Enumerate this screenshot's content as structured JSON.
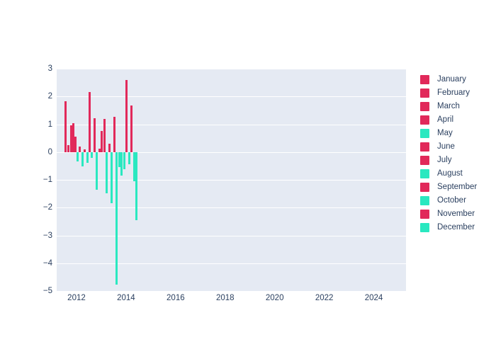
{
  "chart_data": {
    "type": "bar",
    "title": "",
    "subtitle": "",
    "xlabel": "",
    "ylabel": "",
    "xlim": [
      2011.2,
      2025.3
    ],
    "ylim": [
      -5,
      3
    ],
    "xtick_labels": [
      "2012",
      "2014",
      "2016",
      "2018",
      "2020",
      "2022",
      "2024"
    ],
    "xtick_values": [
      2012,
      2014,
      2016,
      2018,
      2020,
      2022,
      2024
    ],
    "ytick_labels": [
      "3",
      "2",
      "1",
      "0",
      "−1",
      "−2",
      "−3",
      "−4",
      "−5"
    ],
    "ytick_values": [
      3,
      2,
      1,
      0,
      -1,
      -2,
      -3,
      -4,
      -5
    ],
    "grid": true,
    "grid_color": "#ffffff",
    "plot_bgcolor": "#e5eaf3",
    "paper_bgcolor": "#ffffff",
    "legend_position": "right",
    "positive_color": "#e1295a",
    "negative_color": "#2ae8c0",
    "legend": [
      {
        "label": "January",
        "color": "#e1295a"
      },
      {
        "label": "February",
        "color": "#e1295a"
      },
      {
        "label": "March",
        "color": "#e1295a"
      },
      {
        "label": "April",
        "color": "#e1295a"
      },
      {
        "label": "May",
        "color": "#2ae8c0"
      },
      {
        "label": "June",
        "color": "#e1295a"
      },
      {
        "label": "July",
        "color": "#e1295a"
      },
      {
        "label": "August",
        "color": "#2ae8c0"
      },
      {
        "label": "September",
        "color": "#e1295a"
      },
      {
        "label": "October",
        "color": "#2ae8c0"
      },
      {
        "label": "November",
        "color": "#e1295a"
      },
      {
        "label": "December",
        "color": "#2ae8c0"
      }
    ],
    "x": [
      2011.55,
      2011.68,
      2011.78,
      2011.87,
      2011.96,
      2012.05,
      2012.14,
      2012.24,
      2012.33,
      2012.43,
      2012.52,
      2012.62,
      2012.72,
      2012.82,
      2012.92,
      2013.02,
      2013.12,
      2013.22,
      2013.32,
      2013.42,
      2013.52,
      2013.62,
      2013.72,
      2013.82,
      2013.92,
      2014.02,
      2014.12,
      2014.22,
      2014.32,
      2014.42
    ],
    "values": [
      1.82,
      0.25,
      0.95,
      1.05,
      0.55,
      -0.35,
      0.2,
      -0.52,
      0.1,
      -0.38,
      2.15,
      -0.22,
      1.22,
      -1.35,
      0.12,
      0.75,
      1.18,
      -1.48,
      0.3,
      -1.83,
      1.28,
      -4.78,
      -0.55,
      -0.85,
      -0.62,
      2.58,
      -0.45,
      1.68,
      -1.05,
      -2.45
    ]
  }
}
